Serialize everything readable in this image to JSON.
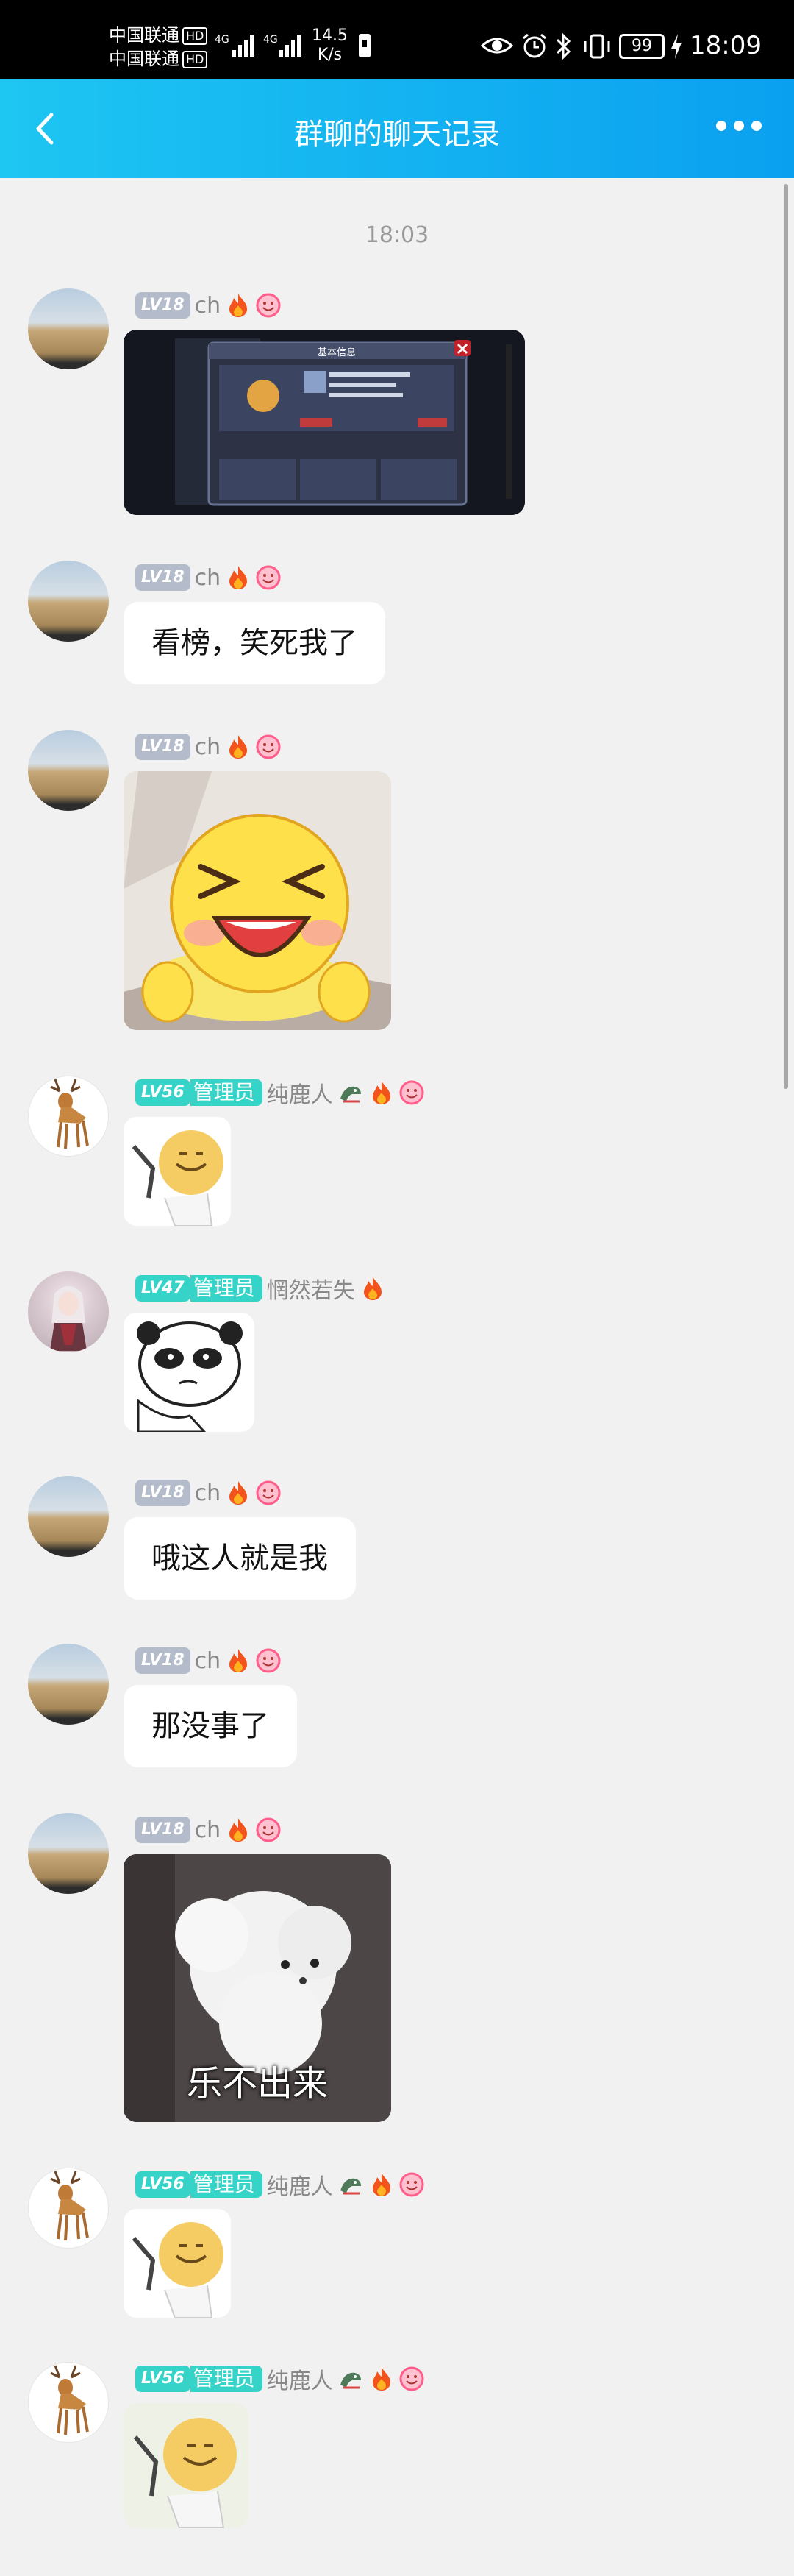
{
  "status_bar": {
    "carrier1": "中国联通",
    "carrier2": "中国联通",
    "hd": "HD",
    "net1": "4G",
    "net2": "4G",
    "speed_value": "14.5",
    "speed_unit": "K/s",
    "battery": "99",
    "time": "18:09"
  },
  "header": {
    "title": "群聊的聊天记录"
  },
  "timestamp": "18:03",
  "messages": [
    {
      "level": "LV18",
      "name": "ch",
      "type": "image",
      "image": "game-screenshot",
      "image_title": "基本信息"
    },
    {
      "level": "LV18",
      "name": "ch",
      "type": "text",
      "text": "看榜，笑死我了"
    },
    {
      "level": "LV18",
      "name": "ch",
      "type": "image",
      "image": "laughing-emoji-sticker"
    },
    {
      "level": "LV56",
      "role": "管理员",
      "name": "纯鹿人",
      "type": "image",
      "image": "smiling-ball-sticker"
    },
    {
      "level": "LV47",
      "role": "管理员",
      "name": "惘然若失",
      "type": "image",
      "image": "panda-meme-sticker"
    },
    {
      "level": "LV18",
      "name": "ch",
      "type": "text",
      "text": "哦这人就是我"
    },
    {
      "level": "LV18",
      "name": "ch",
      "type": "text",
      "text": "那没事了"
    },
    {
      "level": "LV18",
      "name": "ch",
      "type": "image",
      "image": "fluffy-dog-sticker",
      "caption": "乐不出来"
    },
    {
      "level": "LV56",
      "role": "管理员",
      "name": "纯鹿人",
      "type": "image",
      "image": "smiling-ball-sticker"
    },
    {
      "level": "LV56",
      "role": "管理员",
      "name": "纯鹿人",
      "type": "image",
      "image": "smiling-ball-sticker"
    }
  ],
  "colors": {
    "header_start": "#1ec6f2",
    "header_end": "#0aa0f0",
    "background": "#f1f1f1",
    "level_gray": "#b4bccb",
    "level_teal": "#36d4c8"
  }
}
